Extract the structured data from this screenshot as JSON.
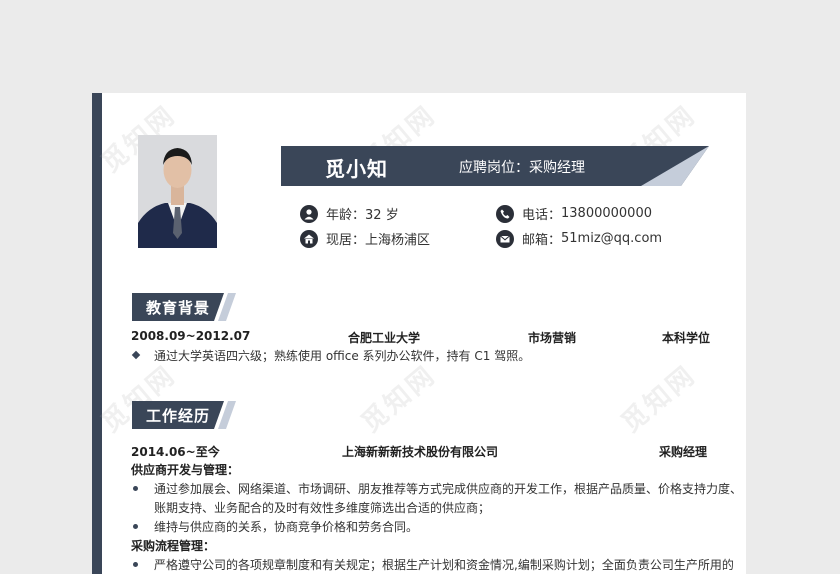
{
  "profile": {
    "name": "觅小知",
    "job_label": "应聘岗位：",
    "job_value": "采购经理",
    "age_label": "年龄：",
    "age_value": "32 岁",
    "phone_label": "电话：",
    "phone_value": "13800000000",
    "residence_label": "现居：",
    "residence_value": "上海杨浦区",
    "email_label": "邮箱：",
    "email_value": "51miz@qq.com"
  },
  "icons": {
    "age": "person-icon",
    "phone": "phone-icon",
    "residence": "home-icon",
    "email": "mail-icon"
  },
  "colors": {
    "accent": "#3a4658",
    "accent_light": "#c5cdda",
    "text": "#333333"
  },
  "watermark": "觅知网",
  "education": {
    "title": "教育背景",
    "period": "2008.09~2012.07",
    "school": "合肥工业大学",
    "major": "市场营销",
    "degree": "本科学位",
    "note": "通过大学英语四六级；熟练使用 office 系列办公软件，持有 C1 驾照。"
  },
  "work": {
    "title": "工作经历",
    "period": "2014.06~至今",
    "company": "上海新新新技术股份有限公司",
    "position": "采购经理",
    "sub1": "供应商开发与管理：",
    "items1": [
      "通过参加展会、网络渠道、市场调研、朋友推荐等方式完成供应商的开发工作，根据产品质量、价格支持力度、",
      "账期支持、业务配合的及时有效性多维度筛选出合适的供应商；",
      "维持与供应商的关系，协商竞争价格和劳务合同。"
    ],
    "sub2": "采购流程管理：",
    "items2": [
      "严格遵守公司的各项规章制度和有关规定；根据生产计划和资金情况,编制采购计划；全面负责公司生产所用的"
    ]
  }
}
